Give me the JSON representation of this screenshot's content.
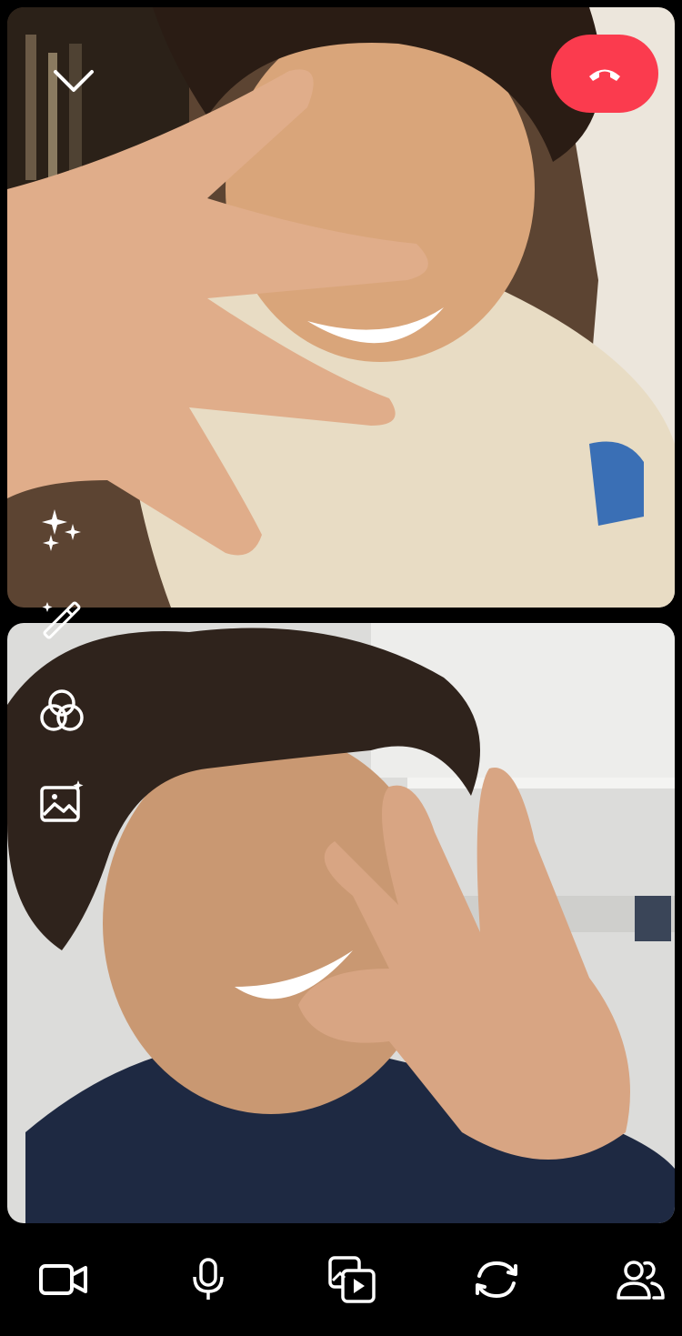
{
  "call": {
    "participants": [
      {
        "role": "remote",
        "video": "remote-video-feed"
      },
      {
        "role": "self",
        "video": "self-video-feed"
      }
    ]
  },
  "colors": {
    "end_call": "#fb3b4e",
    "background": "#000000",
    "icon": "#ffffff"
  },
  "top_controls": {
    "collapse_icon": "chevron-down-icon",
    "end_call_icon": "phone-hangup-icon"
  },
  "side_tools": [
    "sparkles-icon",
    "magic-wand-icon",
    "filters-circles-icon",
    "backdrop-image-icon"
  ],
  "bottom_bar": [
    "video-camera-icon",
    "microphone-icon",
    "media-share-icon",
    "flip-camera-icon",
    "participants-icon"
  ]
}
